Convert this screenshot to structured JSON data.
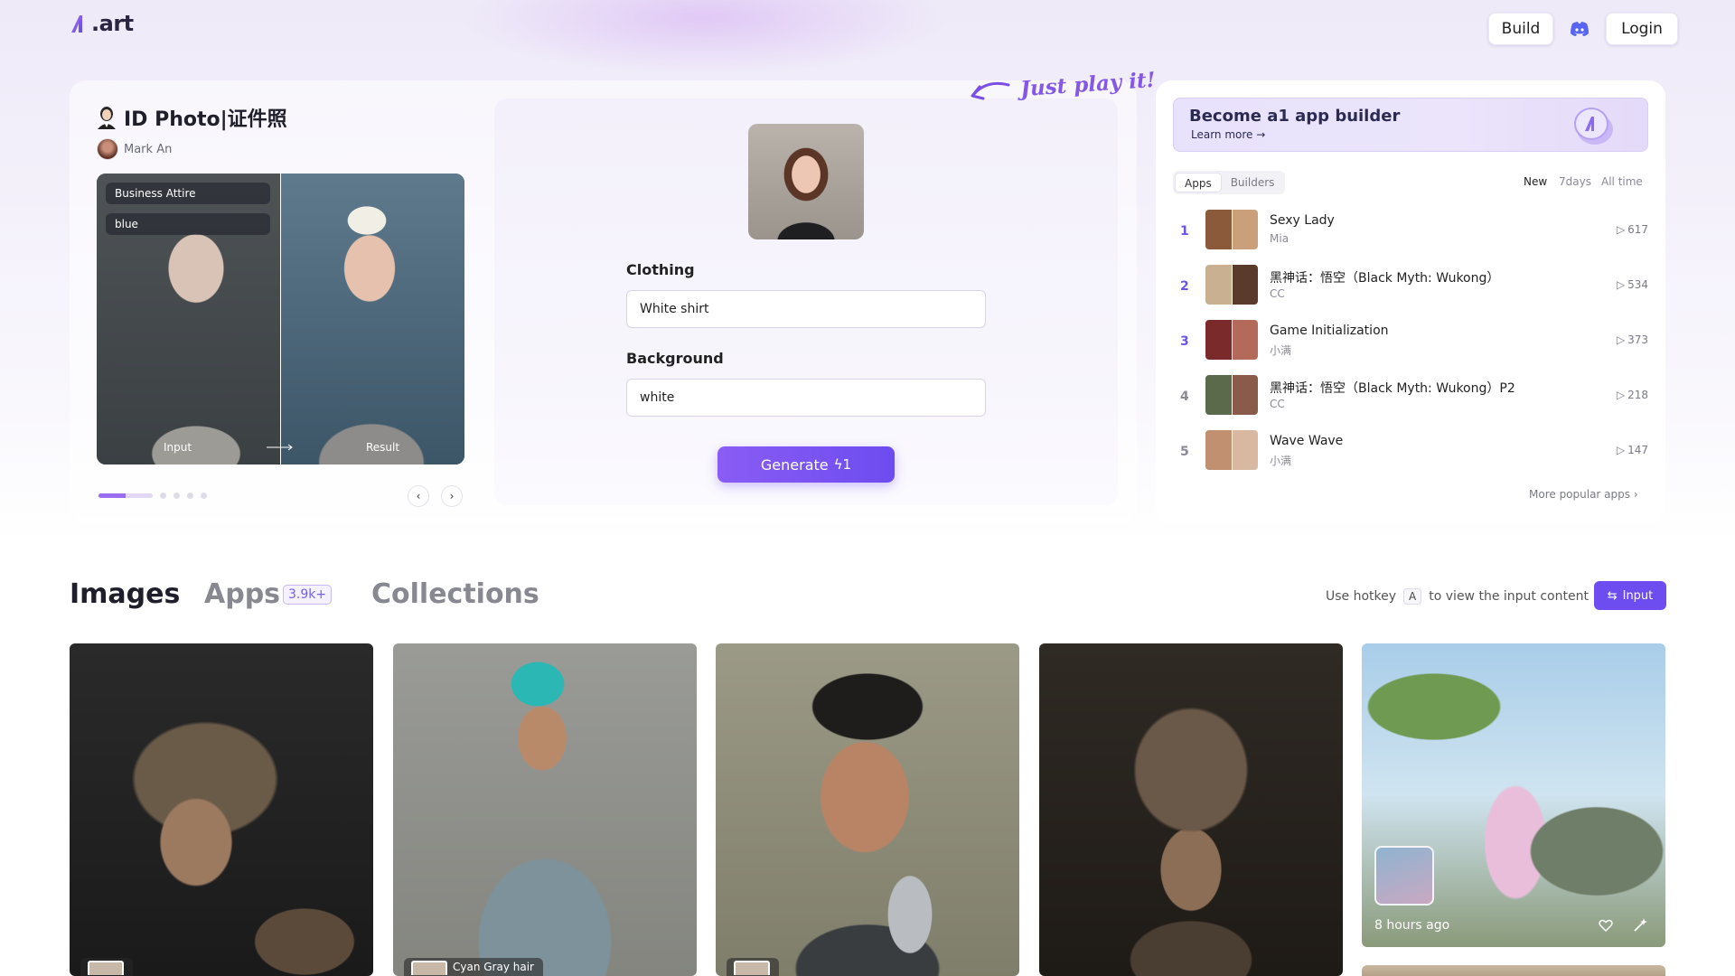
{
  "header": {
    "logo_text": ".art",
    "build_label": "Build",
    "discord_icon": "discord-icon",
    "login_label": "Login"
  },
  "app": {
    "title": "ID Photo|证件照",
    "author": "Mark An",
    "tags": [
      "Business Attire",
      "blue"
    ],
    "input_label": "Input",
    "result_label": "Result",
    "carousel_dots": 5,
    "carousel_active": 1,
    "fields": {
      "clothing_label": "Clothing",
      "clothing_value": "White shirt",
      "background_label": "Background",
      "background_value": "white"
    },
    "generate_label": "Generate",
    "generate_cost": "1",
    "just_play": "Just play it!"
  },
  "sidebar": {
    "promo_title": "Become a1 app builder",
    "promo_sub": "Learn more →",
    "tabs": [
      "Apps",
      "Builders"
    ],
    "active_tab": "Apps",
    "ranges": [
      "New",
      "7days",
      "All time"
    ],
    "active_range": "New",
    "ranking": [
      {
        "rank": "1",
        "name": "Sexy Lady",
        "author": "Mia",
        "count": "617",
        "colors": [
          "#8a5a3a",
          "#c9a07a"
        ]
      },
      {
        "rank": "2",
        "name": "黑神话：悟空（Black Myth: Wukong）",
        "author": "CC",
        "count": "534",
        "colors": [
          "#c8b090",
          "#5a3a2a"
        ]
      },
      {
        "rank": "3",
        "name": "Game Initialization",
        "author": "小满",
        "count": "373",
        "colors": [
          "#7a2a2a",
          "#b46a5a"
        ]
      },
      {
        "rank": "4",
        "name": "黑神话：悟空（Black Myth: Wukong）P2",
        "author": "CC",
        "count": "218",
        "colors": [
          "#5a6a4a",
          "#8a5a4a"
        ]
      },
      {
        "rank": "5",
        "name": "Wave Wave",
        "author": "小满",
        "count": "147",
        "colors": [
          "#c09070",
          "#d8b8a0"
        ]
      }
    ],
    "more_label": "More popular apps"
  },
  "sections": {
    "images": "Images",
    "apps": "Apps",
    "apps_badge": "3.9k+",
    "collections": "Collections",
    "hotkey_pre": "Use hotkey",
    "hotkey_key": "A",
    "hotkey_post": "to view the input content",
    "input_btn": "Input"
  },
  "gallery": {
    "cards": [
      {
        "caption": ""
      },
      {
        "caption": "Cyan Gray hair"
      },
      {
        "caption": ""
      },
      {
        "caption": ""
      },
      {
        "caption": "8 hours ago"
      }
    ]
  },
  "colors": {
    "accent": "#6d4cf0",
    "rank_accent": "#6d53e8"
  }
}
